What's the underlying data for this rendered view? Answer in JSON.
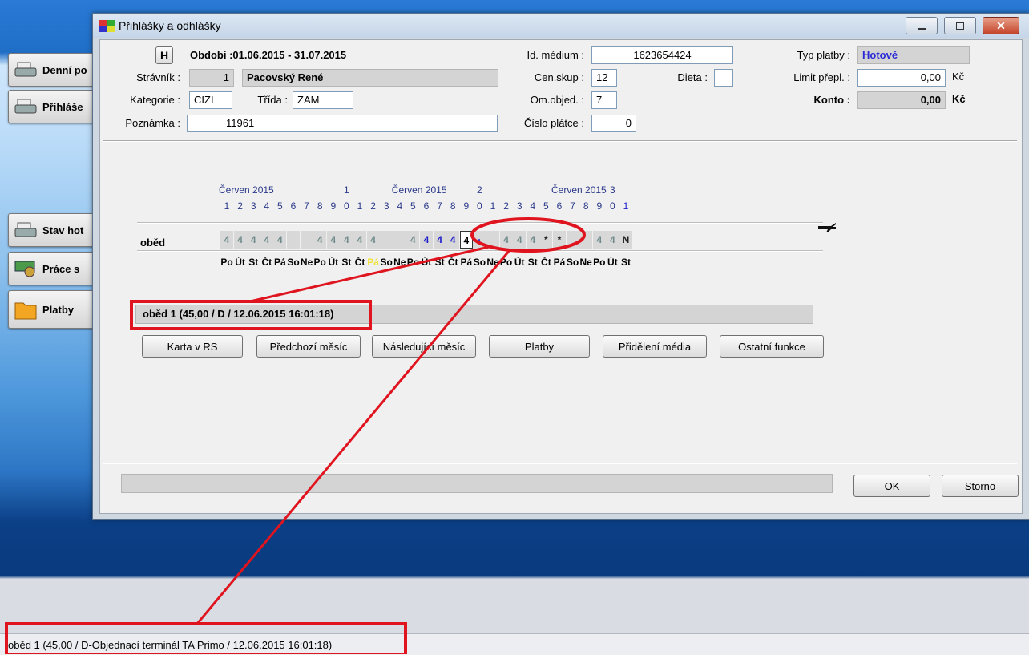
{
  "desktop": {
    "buttons": [
      {
        "label": "Denní po"
      },
      {
        "label": "Přihláše"
      },
      {
        "label": "Stav hot"
      },
      {
        "label": "Práce s"
      },
      {
        "label": "Platby"
      }
    ]
  },
  "window": {
    "title": "Přihlášky a odhlášky",
    "header": {
      "h_button": "H",
      "period": "Obdobi :01.06.2015 - 31.07.2015",
      "stravnik_label": "Strávník :",
      "stravnik_id": "1",
      "stravnik_name": "Pacovský René",
      "kategorie_label": "Kategorie :",
      "kategorie_value": "CIZI",
      "trida_label": "Třída :",
      "trida_value": "ZAM",
      "poznamka_label": "Poznámka :",
      "poznamka_value": "11961",
      "idmedium_label": "Id. médium :",
      "idmedium_value": "1623654424",
      "censkup_label": "Cen.skup :",
      "censkup_value": "12",
      "dieta_label": "Dieta :",
      "dieta_value": "",
      "omobjed_label": "Om.objed. :",
      "omobjed_value": "7",
      "cislo_platce_label": "Číslo plátce :",
      "cislo_platce_value": "0",
      "typ_platby_label": "Typ platby :",
      "typ_platby_value": "Hotově",
      "limit_label": "Limit přepl. :",
      "limit_value": "0,00",
      "limit_unit": "Kč",
      "konto_label": "Konto :",
      "konto_value": "0,00",
      "konto_unit": "Kč"
    },
    "calendar": {
      "month_labels": [
        "Červen 2015",
        "Červen 2015",
        "Červen 2015"
      ],
      "decade_digits": [
        "1",
        "2",
        "3"
      ],
      "day_digits": [
        "1",
        "2",
        "3",
        "4",
        "5",
        "6",
        "7",
        "8",
        "9",
        "0",
        "1",
        "2",
        "3",
        "4",
        "5",
        "6",
        "7",
        "8",
        "9",
        "0",
        "1",
        "2",
        "3",
        "4",
        "5",
        "6",
        "7",
        "8",
        "9",
        "0",
        "1"
      ],
      "row_label": "oběd",
      "cells": [
        "4",
        "4",
        "4",
        "4",
        "4",
        "-",
        "-",
        "4",
        "4",
        "4",
        "4",
        "4",
        "-",
        "-",
        "4",
        "4",
        "4",
        "4",
        "4",
        "-",
        "-",
        "4",
        "4",
        "4",
        "*",
        "*",
        "-",
        "-",
        "4",
        "4",
        "N"
      ],
      "weekdays": [
        "Po",
        "Út",
        "St",
        "Čt",
        "Pá",
        "So",
        "Ne",
        "Po",
        "Út",
        "St",
        "Čt",
        "Pá",
        "So",
        "Ne",
        "Po",
        "Út",
        "St",
        "Čt",
        "Pá",
        "So",
        "Ne",
        "Po",
        "Út",
        "St",
        "Čt",
        "Pá",
        "So",
        "Ne",
        "Po",
        "Út",
        "St"
      ]
    },
    "info_bar": "oběd 1  (45,00 / D / 12.06.2015 16:01:18)",
    "buttons": {
      "karta": "Karta v RS",
      "predchozi": "Předchozí měsíc",
      "nasledujici": "Následující měsíc",
      "platby": "Platby",
      "prideleni": "Přidělení média",
      "ostatni": "Ostatní funkce",
      "ok": "OK",
      "storno": "Storno"
    }
  },
  "statusbar": {
    "text": "oběd 1   (45,00 / D-Objednací terminál TA Primo / 12.06.2015 16:01:18)"
  },
  "colors": {
    "annotation_red": "#e0141e",
    "cell_gray": "#d8d8d8",
    "blue_text": "#1a1acc",
    "typ_platby_blue": "#2b2bd6"
  }
}
